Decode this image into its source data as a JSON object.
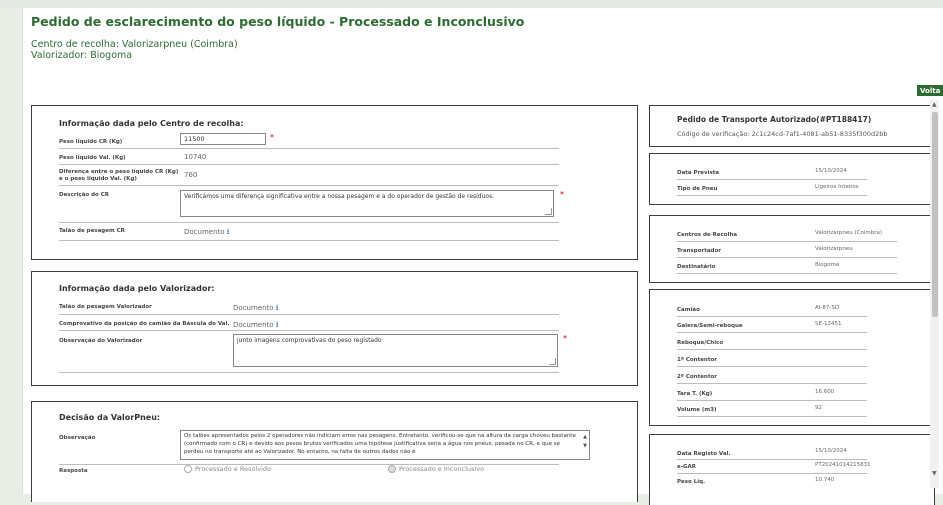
{
  "header": {
    "title": "Pedido de esclarecimento do peso líquido - Processado e Inconclusivo",
    "centro_line": "Centro de recolha: Valorizarpneu (Coimbra)",
    "valorizador_line": "Valorizador: Biogoma",
    "voltar_label": "Volta"
  },
  "cr_panel": {
    "title": "Informação dada pelo Centro de recolha:",
    "peso_cr_label": "Peso líquido CR (Kg)",
    "peso_cr_value": "11500",
    "peso_val_label": "Peso líquido Val. (Kg)",
    "peso_val_value": "10740",
    "diferenca_label_1": "Diferença entre o peso líquido CR (Kg)",
    "diferenca_label_2": "e o peso líquido Val. (Kg)",
    "diferenca_value": "760",
    "descricao_label": "Descrição do CR",
    "descricao_value": "Verificámos uma diferença significativa entre a nossa pesagem e a do operador de gestão de resíduos.",
    "talao_label": "Talão de pesagem CR",
    "talao_doc": "Documento",
    "required_mark": "*"
  },
  "val_panel": {
    "title": "Informação dada pelo Valorizador:",
    "talao_label": "Talão de pesagem Valorizador",
    "talao_doc": "Documento",
    "comprovativo_label": "Comprovativo da posição do camião da Báscula do Val.",
    "comprovativo_doc": "Documento",
    "observacao_label": "Observação do Valorizador",
    "observacao_value": "junto imagens comprovativas do peso registado",
    "required_mark": "*"
  },
  "decisao_panel": {
    "title": "Decisão da ValorPneu:",
    "observacao_label": "Observação",
    "observacao_value": "Os talões apresentados pelos 2 operadores não indiciam erros nas pesagens. Entretanto, verificou-se que na altura da carga choveu bastante (confirmado com o CR) e devido aos pesos brutos verificados uma hipótese justificativa seria a água nos pneus, pesada no CR, e que se perdeu no transporte até ao Valorizador. No entanto, na falta de outros dados não é",
    "resposta_label": "Resposta",
    "option_1": "Processado e Resolvido",
    "option_2": "Processado e Inconclusivo",
    "selected": "Processado e Inconclusivo"
  },
  "pta_panel": {
    "title": "Pedido de Transporte Autorizado(#PT188417)",
    "codigo": "Código de verificação: 2c1c24cd-7af1-4081-ab51-8335f300d2bb"
  },
  "data_panel": {
    "rows": [
      {
        "label": "Data Prevista",
        "value": "15/10/2024"
      },
      {
        "label": "Tipo de Pneu",
        "value": "Ligeiros Inteiros"
      }
    ]
  },
  "centros_panel": {
    "rows": [
      {
        "label": "Centros de Recolha",
        "value": "Valorizarpneu (Coimbra)"
      },
      {
        "label": "Transportador",
        "value": "Valorizarpneu"
      },
      {
        "label": "Destinatário",
        "value": "Biogoma"
      }
    ]
  },
  "camiao_panel": {
    "rows": [
      {
        "label": "Camião",
        "value": "AI-87-SD"
      },
      {
        "label": "Galera/Semi-reboque",
        "value": "SE-13451"
      },
      {
        "label": "Reboque/Chico",
        "value": ""
      },
      {
        "label": "1º Contentor",
        "value": ""
      },
      {
        "label": "2º Contentor",
        "value": ""
      },
      {
        "label": "Tara T. (Kg)",
        "value": "16.600"
      },
      {
        "label": "Volume (m3)",
        "value": "92"
      }
    ]
  },
  "registo_panel": {
    "rows": [
      {
        "label": "Data Registo Val.",
        "value": "15/10/2024"
      },
      {
        "label": "e-GAR",
        "value": "PT20241014215831"
      },
      {
        "label": "Peso Líq.",
        "value": "10.740"
      }
    ]
  },
  "colors": {
    "brand_green": "#2e6b33",
    "required_red": "#cc0000",
    "link_blue": "#2a6fb3"
  }
}
